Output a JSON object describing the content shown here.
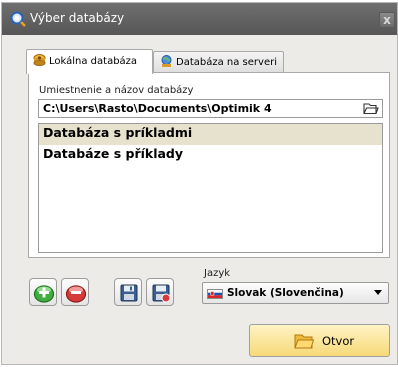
{
  "window": {
    "title": "Výber databázy",
    "close_label": "x"
  },
  "tabs": [
    {
      "label": "Lokálna databáza",
      "icon": "local-database-icon",
      "active": true
    },
    {
      "label": "Databáza na serveri",
      "icon": "server-database-icon",
      "active": false
    }
  ],
  "local": {
    "location_label": "Umiestnenie a názov databázy",
    "path_value": "C:\\Users\\Rasto\\Documents\\Optimik 4",
    "databases": [
      {
        "name": "Databáza s príkladmi",
        "selected": true
      },
      {
        "name": "Databáze s příklady",
        "selected": false
      }
    ]
  },
  "toolbar": {
    "buttons": [
      "add-database-icon",
      "remove-database-icon",
      "save-database-icon",
      "restore-database-icon"
    ]
  },
  "language": {
    "label": "Jazyk",
    "selected": "Slovak (Slovenčina)"
  },
  "actions": {
    "open_label": "Otvor"
  },
  "colors": {
    "titlebar": "#5e5e5e",
    "selected_row": "#e7e2ce",
    "open_button": "#f8e08e",
    "add_green": "#3fae3f",
    "remove_red": "#d63a3a"
  }
}
